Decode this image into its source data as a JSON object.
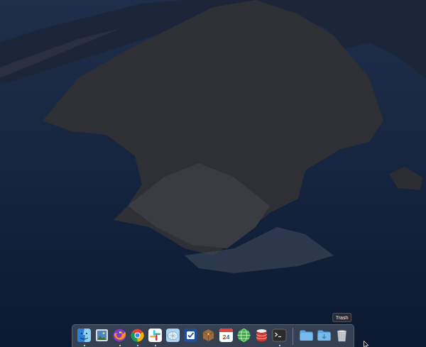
{
  "dock": {
    "apps": [
      {
        "running": true
      },
      {
        "running": false
      },
      {
        "running": true
      },
      {
        "running": true
      },
      {
        "running": true
      },
      {
        "running": false
      },
      {
        "running": false
      },
      {
        "running": false
      },
      {
        "running": false,
        "text": "24"
      },
      {
        "running": false
      },
      {
        "running": false
      },
      {
        "running": true
      }
    ],
    "stacks": [
      {
        "running": false
      },
      {
        "running": false
      },
      {
        "running": false,
        "hovered": true,
        "tooltip": "Trash"
      }
    ]
  }
}
